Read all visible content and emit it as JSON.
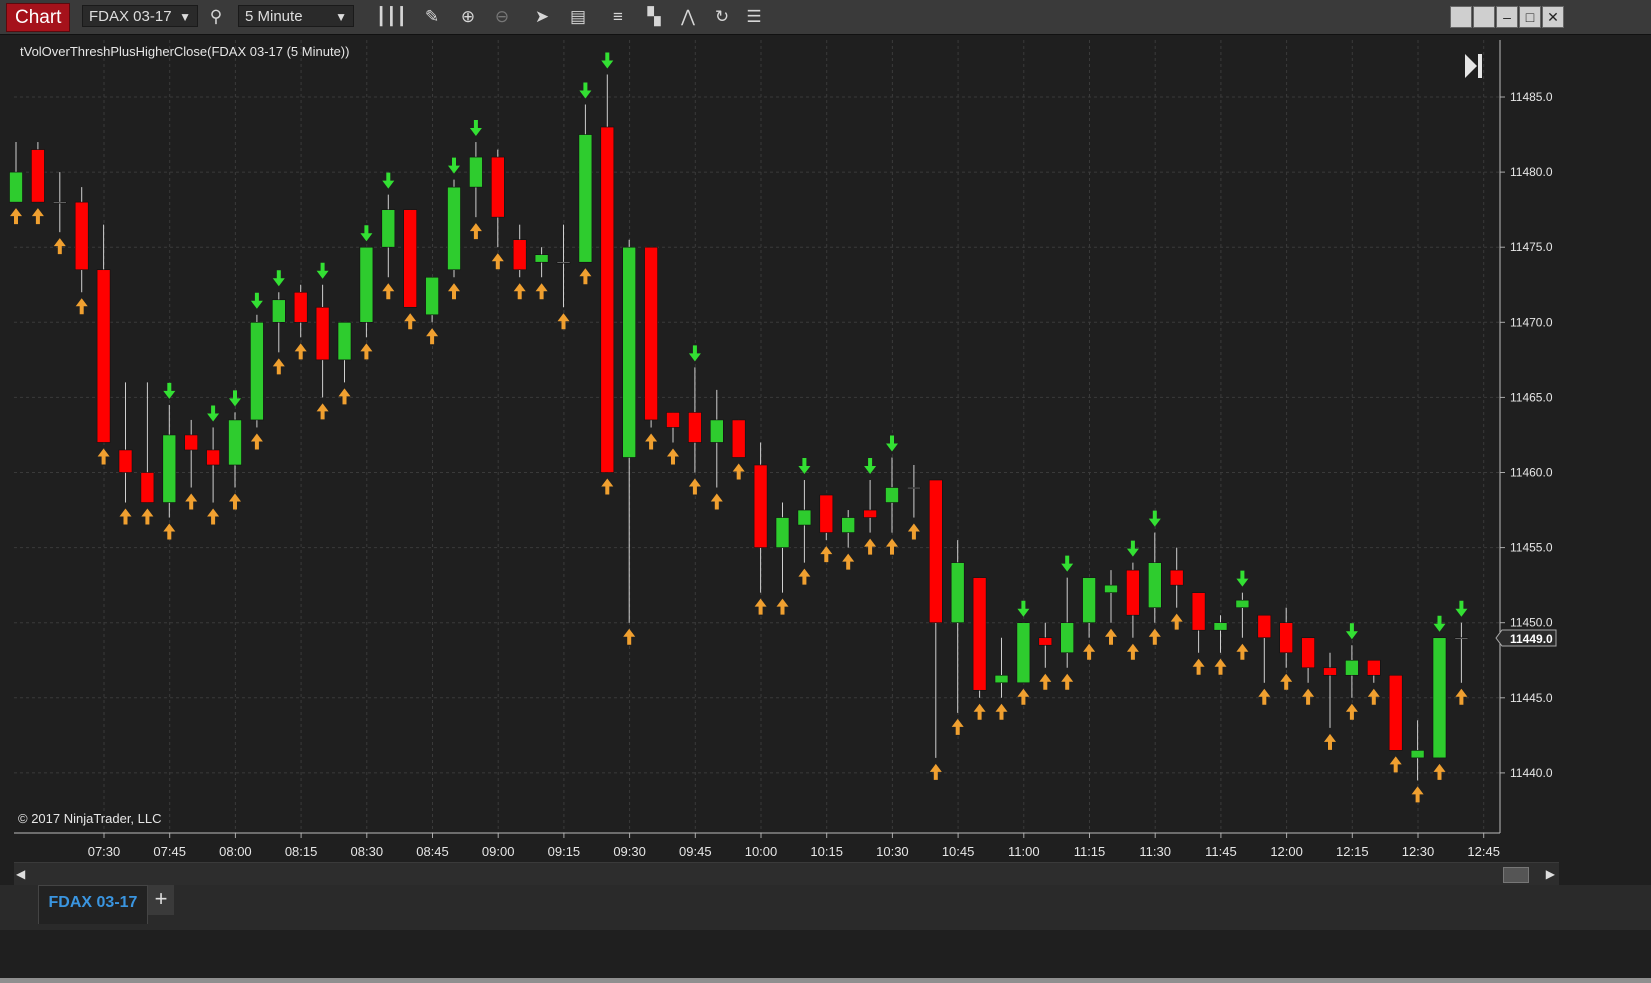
{
  "window": {
    "app_title": "Chart",
    "instrument": "FDAX 03-17",
    "interval": "5 Minute"
  },
  "chart": {
    "indicator_label": "tVolOverThreshPlusHigherClose(FDAX 03-17 (5 Minute))",
    "copyright": "© 2017 NinjaTrader, LLC",
    "last_price_label": "11449.0"
  },
  "tabs": {
    "active": "FDAX 03-17",
    "add": "+"
  },
  "colors": {
    "up": "#2ecc2e",
    "down": "#ff0000",
    "arrow_up": "#f0a030",
    "arrow_down": "#33e033",
    "background": "#1f1f1f",
    "grid": "#3a3a3a"
  },
  "chart_data": {
    "type": "candlestick",
    "ylim": [
      11437.5,
      11488.5
    ],
    "y_ticks": [
      "11485.0",
      "11480.0",
      "11475.0",
      "11470.0",
      "11465.0",
      "11460.0",
      "11455.0",
      "11450.0",
      "11445.0",
      "11440.0"
    ],
    "x_tick_labels": [
      "07:30",
      "07:45",
      "08:00",
      "08:15",
      "08:30",
      "08:45",
      "09:00",
      "09:15",
      "09:30",
      "09:45",
      "10:00",
      "10:15",
      "10:30",
      "10:45",
      "11:00",
      "11:15",
      "11:30",
      "11:45",
      "12:00",
      "12:15",
      "12:30",
      "12:45"
    ],
    "candles": [
      {
        "o": 11478,
        "h": 11482,
        "l": 11478,
        "c": 11480,
        "up": true,
        "dn": false
      },
      {
        "o": 11481.5,
        "h": 11482,
        "l": 11478,
        "c": 11478,
        "up": true,
        "dn": false
      },
      {
        "o": 11478,
        "h": 11480,
        "l": 11476,
        "c": 11478,
        "up": true,
        "dn": false
      },
      {
        "o": 11478,
        "h": 11479,
        "l": 11472,
        "c": 11473.5,
        "up": true,
        "dn": false
      },
      {
        "o": 11473.5,
        "h": 11476.5,
        "l": 11462,
        "c": 11462,
        "up": true,
        "dn": false
      },
      {
        "o": 11461.5,
        "h": 11466,
        "l": 11458,
        "c": 11460,
        "up": true,
        "dn": false
      },
      {
        "o": 11460,
        "h": 11466,
        "l": 11458,
        "c": 11458,
        "up": true,
        "dn": false
      },
      {
        "o": 11458,
        "h": 11464.5,
        "l": 11457,
        "c": 11462.5,
        "up": true,
        "dn": true
      },
      {
        "o": 11462.5,
        "h": 11463.5,
        "l": 11459,
        "c": 11461.5,
        "up": true,
        "dn": false
      },
      {
        "o": 11461.5,
        "h": 11463,
        "l": 11458,
        "c": 11460.5,
        "up": true,
        "dn": true
      },
      {
        "o": 11460.5,
        "h": 11464,
        "l": 11459,
        "c": 11463.5,
        "up": true,
        "dn": true
      },
      {
        "o": 11463.5,
        "h": 11470.5,
        "l": 11463,
        "c": 11470,
        "up": true,
        "dn": true
      },
      {
        "o": 11470,
        "h": 11472,
        "l": 11468,
        "c": 11471.5,
        "up": true,
        "dn": true
      },
      {
        "o": 11472,
        "h": 11472.5,
        "l": 11469,
        "c": 11470,
        "up": true,
        "dn": false
      },
      {
        "o": 11471,
        "h": 11472.5,
        "l": 11465,
        "c": 11467.5,
        "up": true,
        "dn": true
      },
      {
        "o": 11467.5,
        "h": 11470,
        "l": 11466,
        "c": 11470,
        "up": true,
        "dn": false
      },
      {
        "o": 11470,
        "h": 11475,
        "l": 11469,
        "c": 11475,
        "up": true,
        "dn": true
      },
      {
        "o": 11475,
        "h": 11478.5,
        "l": 11473,
        "c": 11477.5,
        "up": true,
        "dn": true
      },
      {
        "o": 11477.5,
        "h": 11477.5,
        "l": 11471,
        "c": 11471,
        "up": true,
        "dn": false
      },
      {
        "o": 11470.5,
        "h": 11473,
        "l": 11470,
        "c": 11473,
        "up": true,
        "dn": false
      },
      {
        "o": 11473.5,
        "h": 11479.5,
        "l": 11473,
        "c": 11479,
        "up": true,
        "dn": true
      },
      {
        "o": 11479,
        "h": 11482,
        "l": 11477,
        "c": 11481,
        "up": true,
        "dn": true
      },
      {
        "o": 11481,
        "h": 11481.5,
        "l": 11475,
        "c": 11477,
        "up": true,
        "dn": false
      },
      {
        "o": 11475.5,
        "h": 11476.5,
        "l": 11473,
        "c": 11473.5,
        "up": true,
        "dn": false
      },
      {
        "o": 11474,
        "h": 11475,
        "l": 11473,
        "c": 11474.5,
        "up": true,
        "dn": false
      },
      {
        "o": 11474,
        "h": 11476.5,
        "l": 11471,
        "c": 11474,
        "up": true,
        "dn": false
      },
      {
        "o": 11474,
        "h": 11484.5,
        "l": 11474,
        "c": 11482.5,
        "up": true,
        "dn": true
      },
      {
        "o": 11483,
        "h": 11486.5,
        "l": 11460,
        "c": 11460,
        "up": true,
        "dn": true
      },
      {
        "o": 11461,
        "h": 11475.5,
        "l": 11450,
        "c": 11475,
        "up": true,
        "dn": false
      },
      {
        "o": 11475,
        "h": 11475,
        "l": 11463,
        "c": 11463.5,
        "up": true,
        "dn": false
      },
      {
        "o": 11464,
        "h": 11464,
        "l": 11462,
        "c": 11463,
        "up": true,
        "dn": false
      },
      {
        "o": 11464,
        "h": 11467,
        "l": 11460,
        "c": 11462,
        "up": true,
        "dn": true
      },
      {
        "o": 11462,
        "h": 11465.5,
        "l": 11459,
        "c": 11463.5,
        "up": true,
        "dn": false
      },
      {
        "o": 11463.5,
        "h": 11463.5,
        "l": 11461,
        "c": 11461,
        "up": true,
        "dn": false
      },
      {
        "o": 11460.5,
        "h": 11462,
        "l": 11452,
        "c": 11455,
        "up": true,
        "dn": false
      },
      {
        "o": 11455,
        "h": 11458,
        "l": 11452,
        "c": 11457,
        "up": true,
        "dn": false
      },
      {
        "o": 11456.5,
        "h": 11459.5,
        "l": 11454,
        "c": 11457.5,
        "up": true,
        "dn": true
      },
      {
        "o": 11458.5,
        "h": 11458.5,
        "l": 11455.5,
        "c": 11456,
        "up": true,
        "dn": false
      },
      {
        "o": 11456,
        "h": 11457.5,
        "l": 11455,
        "c": 11457,
        "up": true,
        "dn": false
      },
      {
        "o": 11457.5,
        "h": 11459.5,
        "l": 11456,
        "c": 11457,
        "up": true,
        "dn": true
      },
      {
        "o": 11458,
        "h": 11461,
        "l": 11456,
        "c": 11459,
        "up": true,
        "dn": true
      },
      {
        "o": 11459,
        "h": 11460.5,
        "l": 11457,
        "c": 11459,
        "up": true,
        "dn": false
      },
      {
        "o": 11459.5,
        "h": 11459.5,
        "l": 11441,
        "c": 11450,
        "up": true,
        "dn": false
      },
      {
        "o": 11450,
        "h": 11455.5,
        "l": 11444,
        "c": 11454,
        "up": true,
        "dn": false
      },
      {
        "o": 11453,
        "h": 11453,
        "l": 11445,
        "c": 11445.5,
        "up": true,
        "dn": false
      },
      {
        "o": 11446,
        "h": 11449,
        "l": 11445,
        "c": 11446.5,
        "up": true,
        "dn": false
      },
      {
        "o": 11446,
        "h": 11450,
        "l": 11446,
        "c": 11450,
        "up": true,
        "dn": true
      },
      {
        "o": 11449,
        "h": 11450,
        "l": 11447,
        "c": 11448.5,
        "up": true,
        "dn": false
      },
      {
        "o": 11448,
        "h": 11453,
        "l": 11447,
        "c": 11450,
        "up": true,
        "dn": true
      },
      {
        "o": 11450,
        "h": 11453,
        "l": 11449,
        "c": 11453,
        "up": true,
        "dn": false
      },
      {
        "o": 11452,
        "h": 11453.5,
        "l": 11450,
        "c": 11452.5,
        "up": true,
        "dn": false
      },
      {
        "o": 11453.5,
        "h": 11454,
        "l": 11449,
        "c": 11450.5,
        "up": true,
        "dn": true
      },
      {
        "o": 11451,
        "h": 11456,
        "l": 11450,
        "c": 11454,
        "up": true,
        "dn": true
      },
      {
        "o": 11453.5,
        "h": 11455,
        "l": 11451,
        "c": 11452.5,
        "up": true,
        "dn": false
      },
      {
        "o": 11452,
        "h": 11452,
        "l": 11448,
        "c": 11449.5,
        "up": true,
        "dn": false
      },
      {
        "o": 11449.5,
        "h": 11450.5,
        "l": 11448,
        "c": 11450,
        "up": true,
        "dn": false
      },
      {
        "o": 11451,
        "h": 11452,
        "l": 11449,
        "c": 11451.5,
        "up": true,
        "dn": true
      },
      {
        "o": 11450.5,
        "h": 11450.5,
        "l": 11446,
        "c": 11449,
        "up": true,
        "dn": false
      },
      {
        "o": 11450,
        "h": 11451,
        "l": 11447,
        "c": 11448,
        "up": true,
        "dn": false
      },
      {
        "o": 11449,
        "h": 11449,
        "l": 11446,
        "c": 11447,
        "up": true,
        "dn": false
      },
      {
        "o": 11447,
        "h": 11448,
        "l": 11443,
        "c": 11446.5,
        "up": true,
        "dn": false
      },
      {
        "o": 11446.5,
        "h": 11448.5,
        "l": 11445,
        "c": 11447.5,
        "up": true,
        "dn": true
      },
      {
        "o": 11447.5,
        "h": 11447.5,
        "l": 11446,
        "c": 11446.5,
        "up": true,
        "dn": false
      },
      {
        "o": 11446.5,
        "h": 11446.5,
        "l": 11441.5,
        "c": 11441.5,
        "up": true,
        "dn": false
      },
      {
        "o": 11441,
        "h": 11443.5,
        "l": 11439.5,
        "c": 11441.5,
        "up": true,
        "dn": false
      },
      {
        "o": 11441,
        "h": 11449,
        "l": 11441,
        "c": 11449,
        "up": true,
        "dn": true
      },
      {
        "o": 11449,
        "h": 11450,
        "l": 11446,
        "c": 11449,
        "up": true,
        "dn": true
      }
    ]
  }
}
